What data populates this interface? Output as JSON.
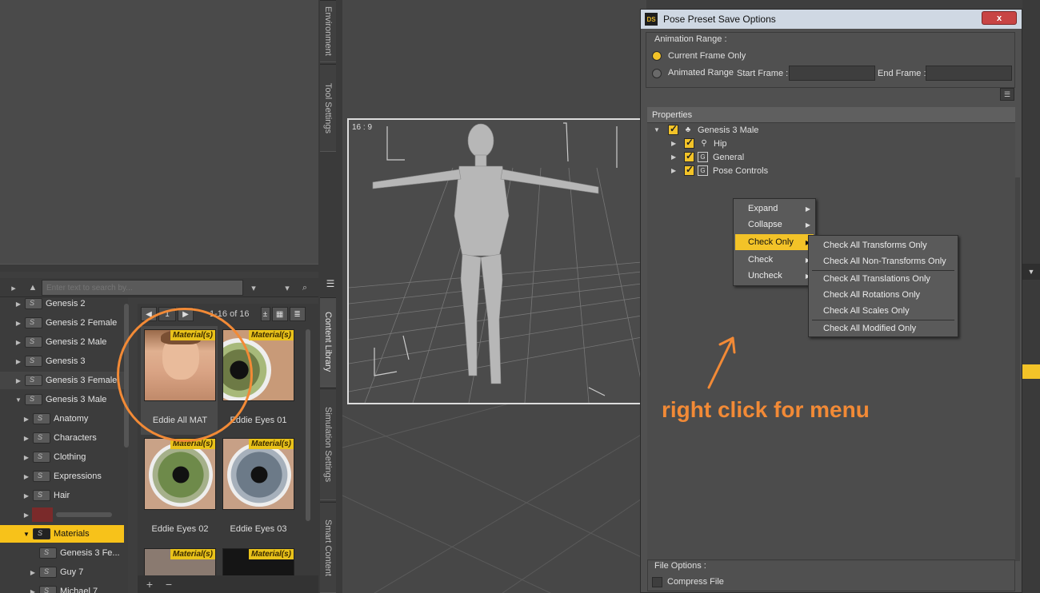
{
  "vertical_tabs_left": [
    "Environment",
    "Tool Settings",
    "Content Library",
    "Simulation Settings",
    "Smart Content"
  ],
  "search": {
    "placeholder": "Enter text to search by..."
  },
  "tree": {
    "items": [
      {
        "label": "Genesis 2",
        "indent": 0
      },
      {
        "label": "Genesis 2 Female",
        "indent": 0
      },
      {
        "label": "Genesis 2 Male",
        "indent": 0
      },
      {
        "label": "Genesis 3",
        "indent": 0
      },
      {
        "label": "Genesis 3 Female",
        "indent": 0
      },
      {
        "label": "Genesis 3 Male",
        "indent": 0
      },
      {
        "label": "Anatomy",
        "indent": 1
      },
      {
        "label": "Characters",
        "indent": 1
      },
      {
        "label": "Clothing",
        "indent": 1
      },
      {
        "label": "Expressions",
        "indent": 1
      },
      {
        "label": "Hair",
        "indent": 1
      },
      {
        "label": "Materials",
        "indent": 1
      },
      {
        "label": "Genesis 3 Fe...",
        "indent": 2
      },
      {
        "label": "Guy 7",
        "indent": 1
      },
      {
        "label": "Michael 7",
        "indent": 1
      }
    ]
  },
  "pager": {
    "page": "1",
    "range": "1-16 of 16"
  },
  "thumbnails": {
    "badge": "Material(s)",
    "items": [
      "Eddie All MAT",
      "Eddie Eyes 01",
      "Eddie Eyes 02",
      "Eddie Eyes 03"
    ]
  },
  "viewport": {
    "aspect_label": "16 : 9"
  },
  "dialog": {
    "title": "Pose Preset Save Options",
    "icon": "DS",
    "close_label": "x",
    "animation_range": {
      "title": "Animation Range :",
      "current_frame": "Current Frame Only",
      "animated_range": "Animated Range",
      "start_frame_label": "Start Frame :",
      "end_frame_label": "End Frame :",
      "start_frame_value": "",
      "end_frame_value": ""
    },
    "properties": {
      "header": "Properties",
      "root": "Genesis 3 Male",
      "children": [
        "Hip",
        "General",
        "Pose Controls"
      ]
    },
    "file_options": {
      "title": "File Options :",
      "compress": "Compress File"
    }
  },
  "context_menu": {
    "items": [
      "Expand",
      "Collapse",
      "Check Only",
      "Check",
      "Uncheck"
    ],
    "highlighted": "Check Only"
  },
  "submenu": {
    "items": [
      "Check All Transforms Only",
      "Check All Non-Transforms Only",
      "Check All Translations Only",
      "Check All Rotations Only",
      "Check All Scales Only",
      "Check All Modified Only"
    ]
  },
  "annotation": "right click for menu",
  "colors": {
    "accent": "#f3c328",
    "annotation": "#f28a36",
    "title_bar": "#cfd8e3"
  }
}
